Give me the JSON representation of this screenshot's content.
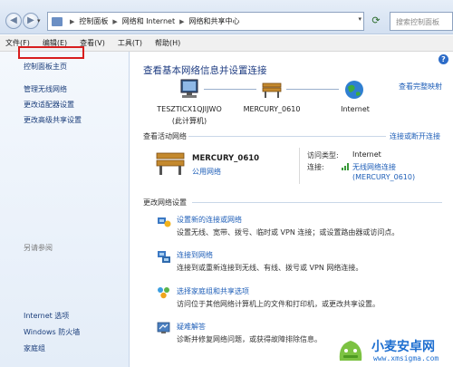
{
  "address_bar": {
    "crumbs": [
      "控制面板",
      "网络和 Internet",
      "网络和共享中心"
    ],
    "search_placeholder": "搜索控制面板"
  },
  "menu": [
    "文件(F)",
    "编辑(E)",
    "查看(V)",
    "工具(T)",
    "帮助(H)"
  ],
  "sidebar": {
    "home": "控制面板主页",
    "links": [
      "管理无线网络",
      "更改适配器设置",
      "更改高级共享设置"
    ],
    "see_also_heading": "另请参阅",
    "see_also": [
      "Internet 选项",
      "Windows 防火墙",
      "家庭组"
    ]
  },
  "main": {
    "title": "查看基本网络信息并设置连接",
    "view_full_map": "查看完整映射",
    "map": {
      "computer": "TESZTICX1QJIJWO",
      "computer_sub": "(此计算机)",
      "network": "MERCURY_0610",
      "internet": "Internet"
    },
    "active_heading": "查看活动网络",
    "connect_disconnect": "连接或断开连接",
    "active": {
      "name": "MERCURY_0610",
      "type": "公用网络",
      "access_label": "访问类型:",
      "access_value": "Internet",
      "conn_label": "连接:",
      "conn_value": "无线网络连接",
      "conn_value2": "(MERCURY_0610)"
    },
    "change_heading": "更改网络设置",
    "tasks": [
      {
        "title": "设置新的连接或网络",
        "desc": "设置无线、宽带、拨号、临时或 VPN 连接；或设置路由器或访问点。"
      },
      {
        "title": "连接到网络",
        "desc": "连接到或重新连接到无线、有线、拨号或 VPN 网络连接。"
      },
      {
        "title": "选择家庭组和共享选项",
        "desc": "访问位于其他网络计算机上的文件和打印机，或更改共享设置。"
      },
      {
        "title": "疑难解答",
        "desc": "诊断并修复网络问题，或获得故障排除信息。"
      }
    ]
  },
  "watermark": {
    "text": "小麦安卓网",
    "url": "www.xmsigma.com"
  },
  "colors": {
    "link": "#1f5fb8",
    "title": "#1e3c82",
    "highlight_box": "#d81e1e"
  }
}
